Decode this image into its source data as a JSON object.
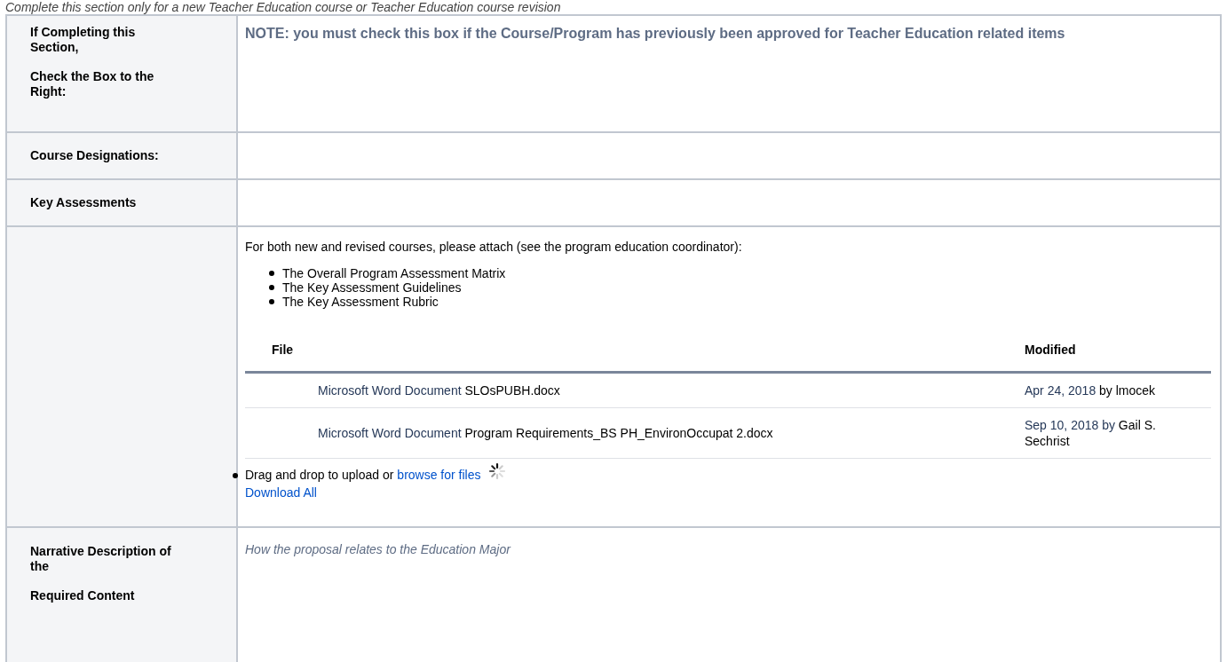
{
  "intro": "Complete this section only for a new Teacher Education course or Teacher Education course revision",
  "rows": [
    {
      "kind": "note",
      "label": [
        "If Completing this Section,",
        "Check the Box to the Right:"
      ],
      "note": "NOTE: you must check this box if the Course/Program has previously been approved for Teacher Education related items"
    },
    {
      "kind": "empty",
      "label": [
        "Course Designations:"
      ]
    },
    {
      "kind": "empty",
      "label": [
        "Key Assessments"
      ]
    },
    {
      "kind": "attachments",
      "label": [],
      "intro": "For both new and revised courses, please attach (see the program education coordinator):",
      "bullets": [
        "The Overall Program Assessment Matrix",
        "The Key Assessment Guidelines",
        "The Key Assessment Rubric"
      ],
      "columns": [
        "File",
        "Modified"
      ],
      "files": [
        {
          "type": "Microsoft Word Document",
          "name": "SLOsPUBH.docx",
          "date_link": "Apr 24, 2018",
          "author": "by lmocek"
        },
        {
          "type": "Microsoft Word Document",
          "name": "Program Requirements_BS PH_EnvironOccupat 2.docx",
          "date_link": "Sep 10, 2018 by",
          "author": "Gail S. Sechrist"
        }
      ],
      "upload_text": "Drag and drop to upload or",
      "browse_link": "browse for files",
      "download_link": "Download All"
    },
    {
      "kind": "placeholder",
      "label": [
        "Narrative Description of the",
        "Required Content"
      ],
      "placeholder": "How the proposal relates to the Education Major"
    }
  ]
}
